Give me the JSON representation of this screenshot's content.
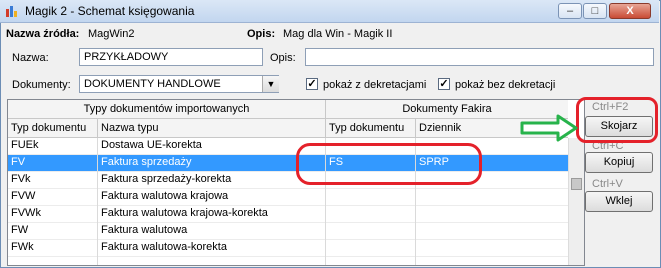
{
  "window": {
    "title": "Magik 2 - Schemat księgowania",
    "minimize": "–",
    "maximize": "□",
    "close": "X"
  },
  "header": {
    "source_label": "Nazwa źródła:",
    "source_value": "MagWin2",
    "desc_label": "Opis:",
    "desc_value": "Mag dla Win - Magik II"
  },
  "form": {
    "name_label": "Nazwa:",
    "name_value": "PRZYKŁADOWY",
    "opis_label": "Opis:",
    "opis_value": "",
    "docs_label": "Dokumenty:",
    "docs_value": "DOKUMENTY HANDLOWE",
    "chk1_label": "pokaż z dekretacjami",
    "chk1_mark": "✓",
    "chk2_label": "pokaż bez dekretacji",
    "chk2_mark": "✓"
  },
  "grid": {
    "group_left": "Typy dokumentów importowanych",
    "group_right": "Dokumenty Fakira",
    "columns": [
      "Typ dokumentu",
      "Nazwa typu",
      "Typ dokumentu",
      "Dziennik"
    ],
    "rows": [
      [
        "FUEk",
        "Dostawa UE-korekta",
        "",
        ""
      ],
      [
        "FV",
        "Faktura sprzedaży",
        "FS",
        "SPRP"
      ],
      [
        "FVk",
        "Faktura sprzedaży-korekta",
        "",
        ""
      ],
      [
        "FVW",
        "Faktura walutowa krajowa",
        "",
        ""
      ],
      [
        "FVWk",
        "Faktura walutowa krajowa-korekta",
        "",
        ""
      ],
      [
        "FW",
        "Faktura walutowa",
        "",
        ""
      ],
      [
        "FWk",
        "Faktura walutowa-korekta",
        "",
        ""
      ]
    ]
  },
  "actions": {
    "hint1": "Ctrl+F2",
    "btn1": "Skojarz",
    "hint2": "Ctrl+C",
    "btn2": "Kopiuj",
    "hint3": "Ctrl+V",
    "btn3": "Wklej"
  }
}
